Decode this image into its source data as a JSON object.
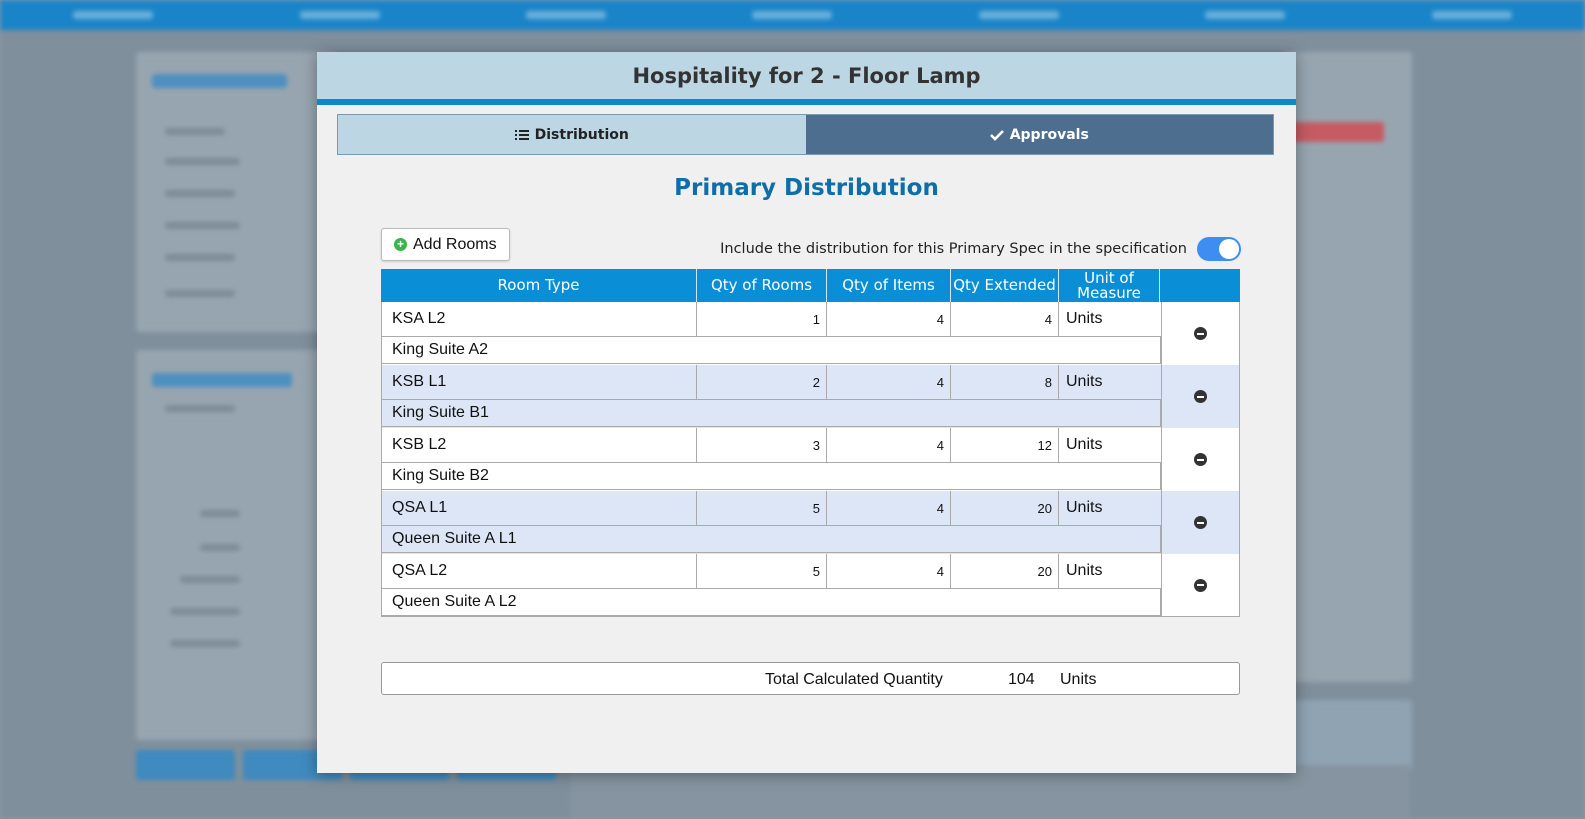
{
  "modal": {
    "title": "Hospitality for 2 - Floor Lamp",
    "tabs": [
      {
        "label": "Distribution",
        "icon": "list-icon",
        "active": true
      },
      {
        "label": "Approvals",
        "icon": "check-icon",
        "active": false
      }
    ],
    "section_title": "Primary Distribution",
    "add_rooms_label": "Add Rooms",
    "include_label": "Include the distribution for this Primary Spec in the specification",
    "include_enabled": true,
    "columns": [
      "Room Type",
      "Qty of Rooms",
      "Qty of Items",
      "Qty Extended",
      "Unit of Measure"
    ],
    "rows": [
      {
        "code": "KSA L2",
        "name": "King Suite A2",
        "rooms": "1",
        "items": "4",
        "extended": "4",
        "unit": "Units"
      },
      {
        "code": "KSB L1",
        "name": "King Suite B1",
        "rooms": "2",
        "items": "4",
        "extended": "8",
        "unit": "Units"
      },
      {
        "code": "KSB L2",
        "name": "King Suite B2",
        "rooms": "3",
        "items": "4",
        "extended": "12",
        "unit": "Units"
      },
      {
        "code": "QSA L1",
        "name": "Queen Suite A L1",
        "rooms": "5",
        "items": "4",
        "extended": "20",
        "unit": "Units"
      },
      {
        "code": "QSA L2",
        "name": "Queen Suite A L2",
        "rooms": "5",
        "items": "4",
        "extended": "20",
        "unit": "Units"
      }
    ],
    "total": {
      "label": "Total Calculated Quantity",
      "value": "104",
      "unit": "Units"
    }
  },
  "colors": {
    "accent": "#0a8fd6",
    "header_bg": "#bcd6e4",
    "tab_inactive": "#4e6e90",
    "row_alt": "#dde6f7",
    "toggle_on": "#3d8ef0",
    "title_blue": "#0e6ea8"
  }
}
